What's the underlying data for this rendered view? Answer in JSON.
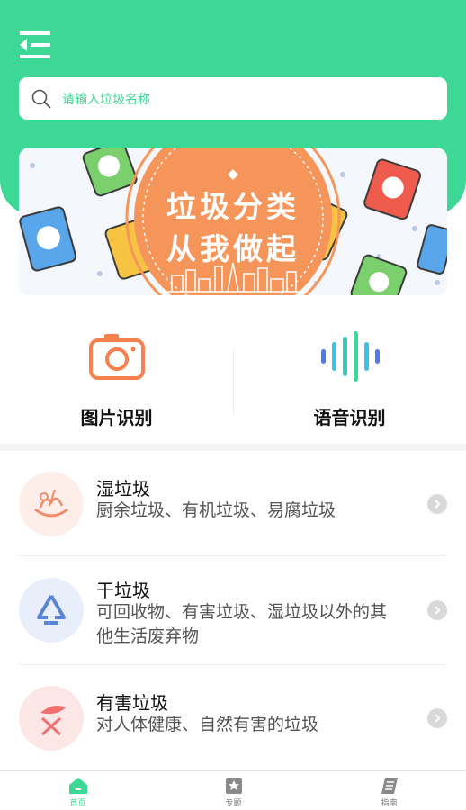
{
  "search": {
    "placeholder": "请输入垃圾名称"
  },
  "banner": {
    "line1": "垃圾分类",
    "line2": "从我做起"
  },
  "features": [
    {
      "label": "图片识别",
      "icon": "camera-icon"
    },
    {
      "label": "语音识别",
      "icon": "voice-wave-icon"
    }
  ],
  "categories": [
    {
      "title": "湿垃圾",
      "desc": "厨余垃圾、有机垃圾、易腐垃圾",
      "icon": "wet-waste-icon"
    },
    {
      "title": "干垃圾",
      "desc": "可回收物、有害垃圾、湿垃圾以外的其他生活废弃物",
      "icon": "recycle-triangle-icon"
    },
    {
      "title": "有害垃圾",
      "desc": "对人体健康、自然有害的垃圾",
      "icon": "hazardous-waste-icon"
    }
  ],
  "tabbar": {
    "items": [
      {
        "label": "首页",
        "icon": "home-icon",
        "active": true
      },
      {
        "label": "专题",
        "icon": "star-bookmark-icon",
        "active": false
      },
      {
        "label": "指南",
        "icon": "guide-book-icon",
        "active": false
      }
    ]
  },
  "colors": {
    "primary": "#3dd896",
    "camera_orange": "#f7804f",
    "banner_orange": "#f5955a",
    "wet_bg": "#fdeee9",
    "dry_bg": "#e9eefb",
    "hazard_bg": "#fde6e6",
    "arrow_gray": "#d9d9d9"
  }
}
